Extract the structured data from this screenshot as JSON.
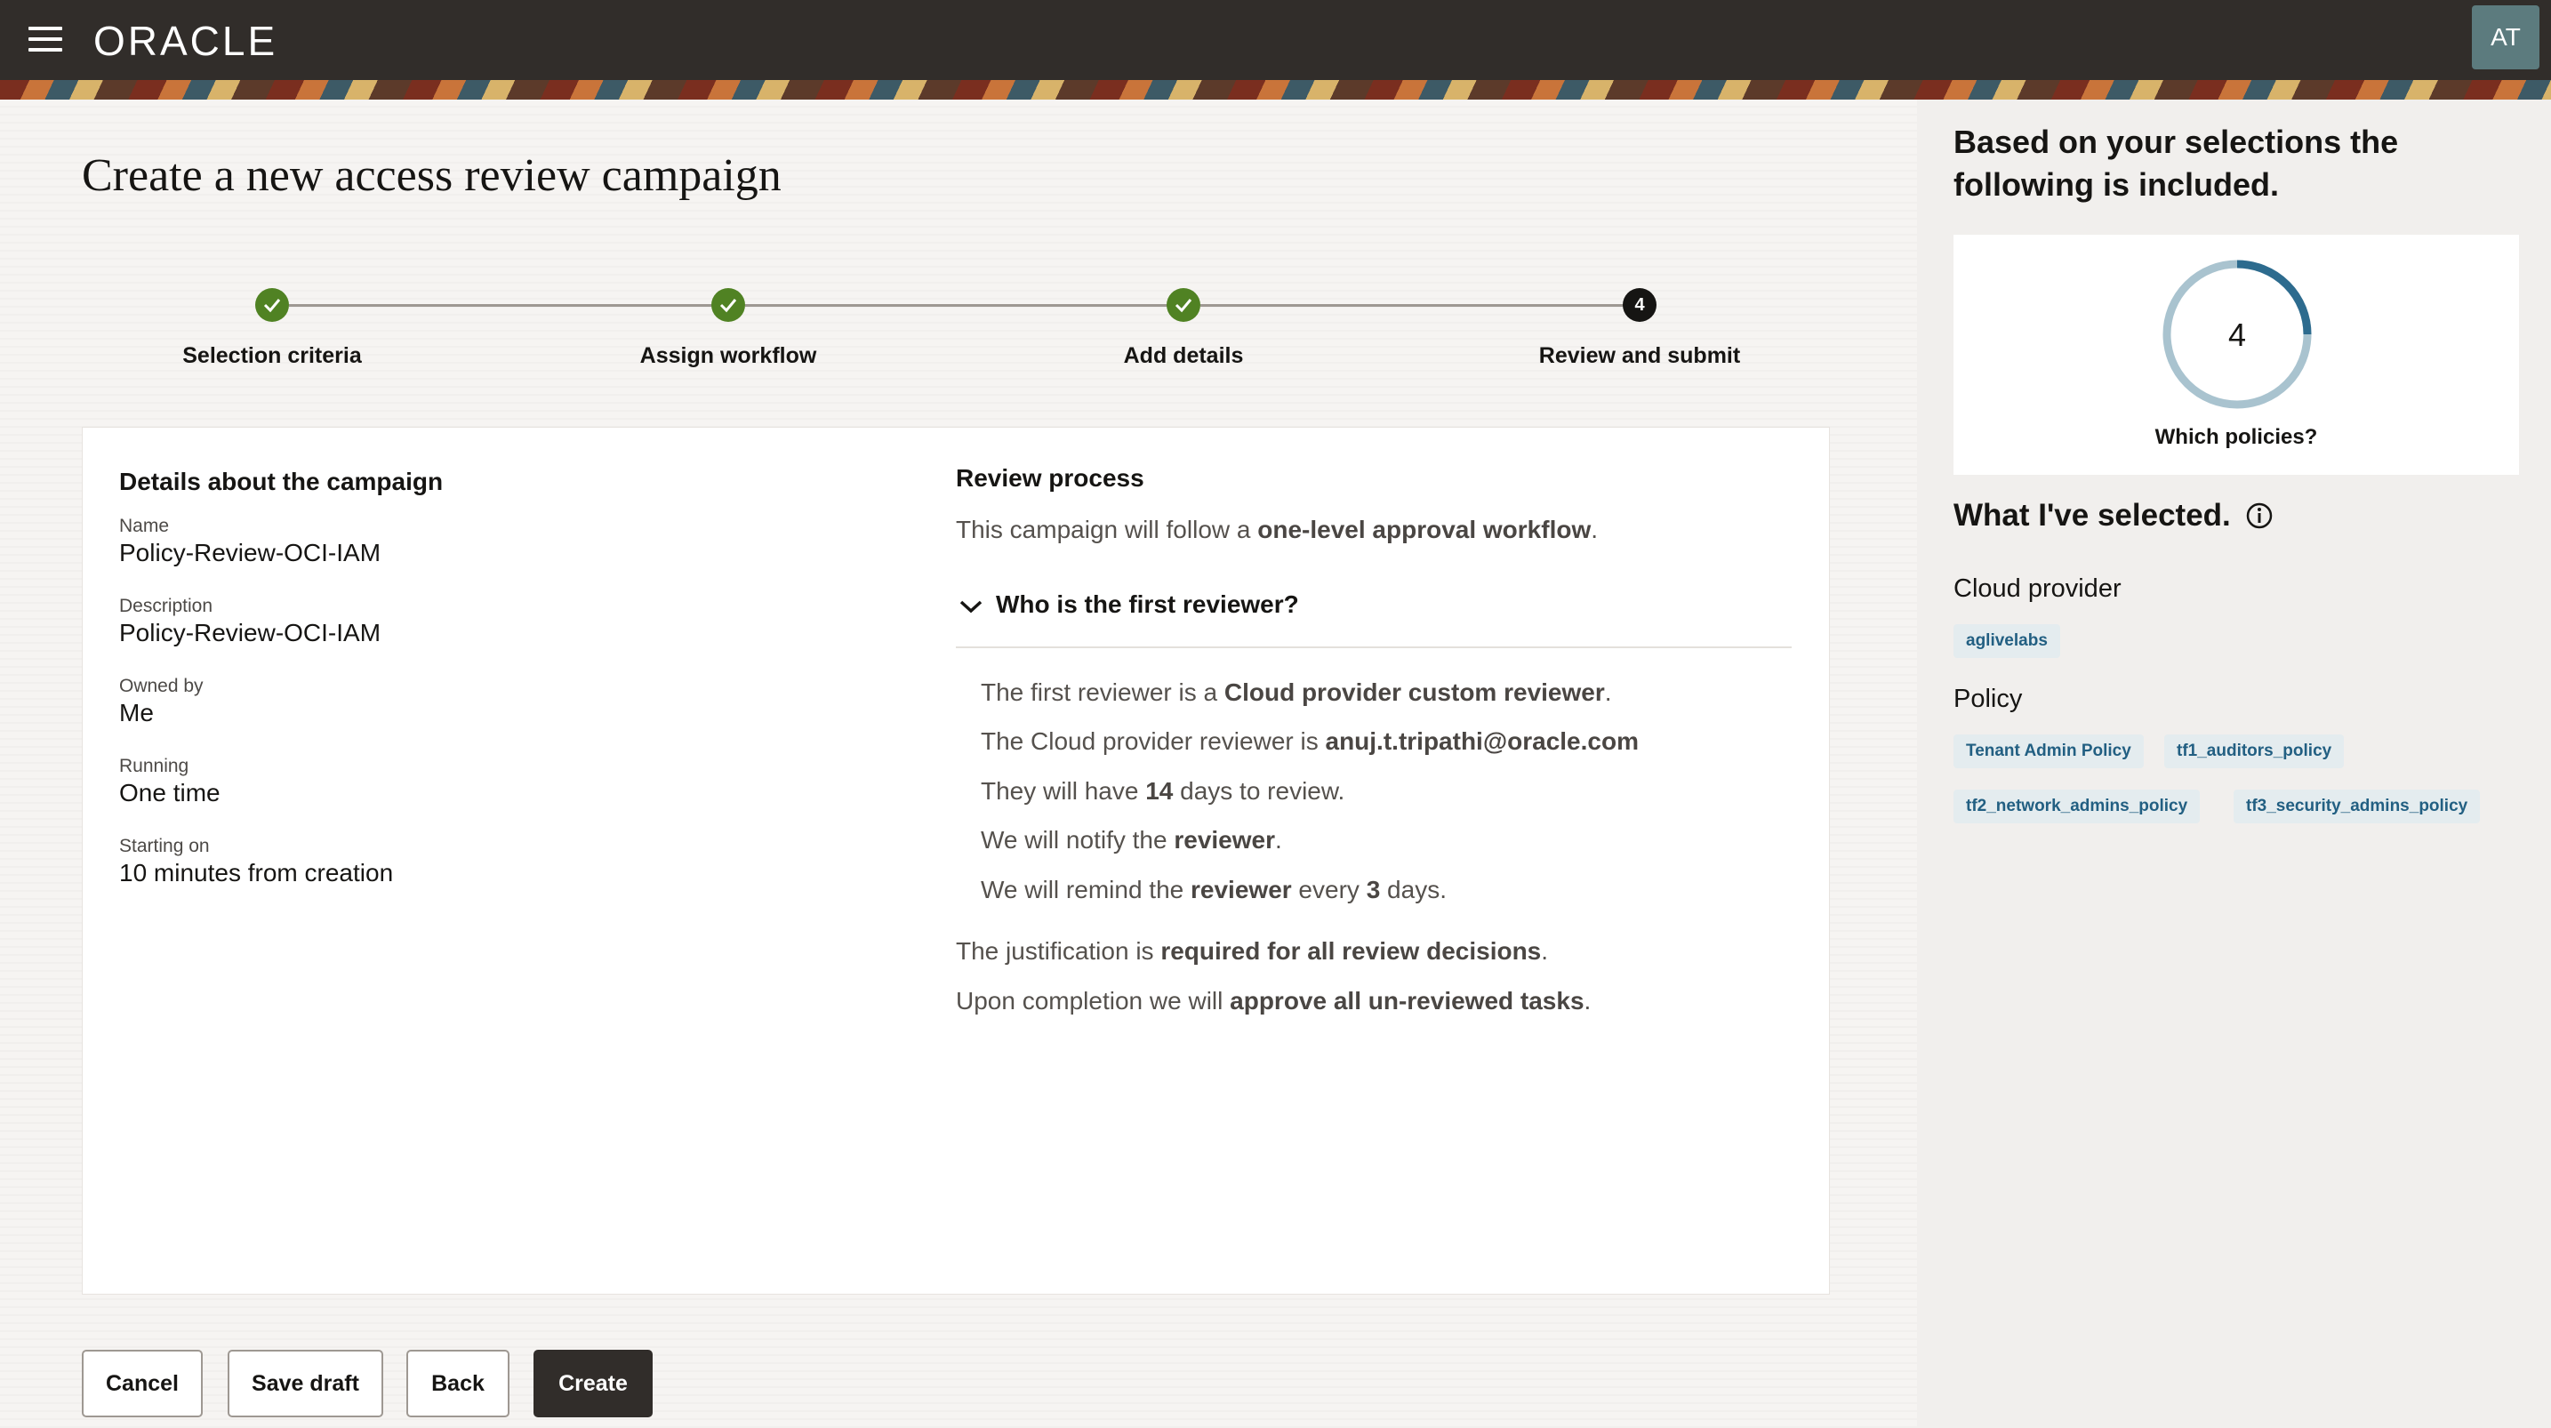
{
  "header": {
    "brand": "ORACLE",
    "avatar_initials": "AT"
  },
  "page": {
    "title": "Create a new access review campaign"
  },
  "stepper": {
    "steps": [
      {
        "label": "Selection criteria",
        "status": "complete"
      },
      {
        "label": "Assign workflow",
        "status": "complete"
      },
      {
        "label": "Add details",
        "status": "complete"
      },
      {
        "label": "Review and submit",
        "status": "current",
        "number": "4"
      }
    ]
  },
  "details": {
    "heading": "Details about the campaign",
    "fields": [
      {
        "label": "Name",
        "value": "Policy-Review-OCI-IAM"
      },
      {
        "label": "Description",
        "value": "Policy-Review-OCI-IAM"
      },
      {
        "label": "Owned by",
        "value": "Me"
      },
      {
        "label": "Running",
        "value": "One time"
      },
      {
        "label": "Starting on",
        "value": "10 minutes from creation"
      }
    ]
  },
  "review": {
    "heading": "Review process",
    "intro": {
      "pre": "This campaign will follow a ",
      "b1": "one-level approval workflow",
      "post": "."
    },
    "accordion_title": "Who is the first reviewer?",
    "reviewer_lines": [
      {
        "pre": "The first reviewer is a ",
        "b1": "Cloud provider custom reviewer",
        "mid": ".",
        "b2": "",
        "post": ""
      },
      {
        "pre": "The Cloud provider reviewer is ",
        "b1": "anuj.t.tripathi@oracle.com",
        "mid": "",
        "b2": "",
        "post": ""
      },
      {
        "pre": "They will have ",
        "b1": "14",
        "mid": " days to review.",
        "b2": "",
        "post": ""
      },
      {
        "pre": "We will notify the ",
        "b1": "reviewer",
        "mid": ".",
        "b2": "",
        "post": ""
      },
      {
        "pre": "We will remind the ",
        "b1": "reviewer",
        "mid": " every ",
        "b2": "3",
        "post": " days."
      }
    ],
    "justification": {
      "pre": "The justification is ",
      "b1": "required for all review decisions",
      "post": "."
    },
    "completion": {
      "pre": "Upon completion we will ",
      "b1": "approve all un-reviewed tasks",
      "post": "."
    }
  },
  "actions": {
    "cancel": "Cancel",
    "save_draft": "Save draft",
    "back": "Back",
    "create": "Create"
  },
  "summary": {
    "heading": "Based on your selections the following is included.",
    "donut": {
      "value": "4",
      "label": "Which policies?",
      "fraction": 0.25,
      "color_track": "#a9c3cf",
      "color_fill": "#2d6b8e"
    },
    "selected_heading": "What I've selected.",
    "cloud_provider_label": "Cloud provider",
    "cloud_providers": [
      "aglivelabs"
    ],
    "policy_label": "Policy",
    "policies": [
      "Tenant Admin Policy",
      "tf1_auditors_policy",
      "tf2_network_admins_policy",
      "tf3_security_admins_policy"
    ]
  },
  "colors": {
    "header_bg": "#312d2a",
    "step_complete": "#508223",
    "chip_bg": "#e4ecef",
    "chip_text": "#225f82",
    "primary_button": "#312d2a"
  },
  "icons": {
    "menu": "hamburger-icon",
    "step_done": "check-icon",
    "accordion": "chevron-down-icon",
    "info": "info-icon"
  }
}
